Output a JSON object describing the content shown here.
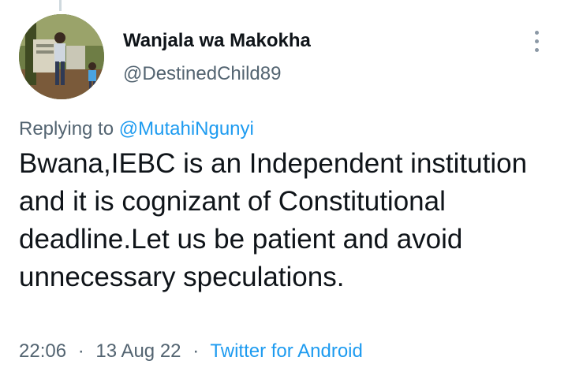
{
  "tweet": {
    "author_name": "Wanjala wa Makokha",
    "author_handle": "@DestinedChild89",
    "replying_prefix": "Replying to",
    "replying_to": "@MutahiNgunyi",
    "text": "Bwana,IEBC is an Independent institution and it is cognizant of Constitutional deadline.Let us be patient and avoid unnecessary speculations.",
    "time": "22:06",
    "separator": "·",
    "date": "13 Aug 22",
    "source": "Twitter for Android"
  },
  "icons": {
    "more": "more-vertical-icon"
  },
  "colors": {
    "link": "#1d9bf0",
    "secondary_text": "#536471",
    "primary_text": "#0f1419"
  }
}
